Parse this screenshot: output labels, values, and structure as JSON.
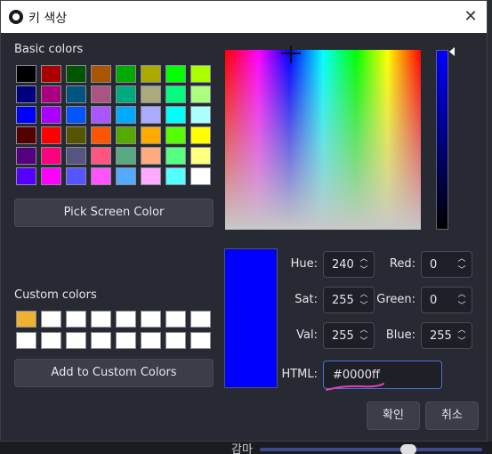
{
  "window": {
    "title": "키 색상",
    "close": "✕"
  },
  "basic": {
    "label": "Basic colors",
    "swatches": [
      "#000000",
      "#aa0000",
      "#005500",
      "#aa5500",
      "#00aa00",
      "#aaaa00",
      "#00ff00",
      "#aaff00",
      "#00007f",
      "#aa007f",
      "#00557f",
      "#aa557f",
      "#00aa7f",
      "#aaaa7f",
      "#00ff7f",
      "#aaff7f",
      "#0000ff",
      "#aa00ff",
      "#0055ff",
      "#aa55ff",
      "#00aaff",
      "#aaaaff",
      "#00ffff",
      "#aaffff",
      "#550000",
      "#ff0000",
      "#555500",
      "#ff5500",
      "#55aa00",
      "#ffaa00",
      "#55ff00",
      "#ffff00",
      "#55007f",
      "#ff007f",
      "#55557f",
      "#ff557f",
      "#55aa7f",
      "#ffaa7f",
      "#55ff7f",
      "#ffff7f",
      "#5500ff",
      "#ff00ff",
      "#5555ff",
      "#ff55ff",
      "#55aaff",
      "#ffaaff",
      "#55ffff",
      "#ffffff"
    ]
  },
  "pick_screen_label": "Pick Screen Color",
  "custom": {
    "label": "Custom colors",
    "swatches": [
      "#f0b030",
      "#ffffff",
      "#ffffff",
      "#ffffff",
      "#ffffff",
      "#ffffff",
      "#ffffff",
      "#ffffff",
      "#ffffff",
      "#ffffff",
      "#ffffff",
      "#ffffff",
      "#ffffff",
      "#ffffff",
      "#ffffff",
      "#ffffff"
    ]
  },
  "add_custom_label": "Add to Custom Colors",
  "fields": {
    "hue": {
      "label": "Hue:",
      "value": "240"
    },
    "sat": {
      "label": "Sat:",
      "value": "255"
    },
    "val": {
      "label": "Val:",
      "value": "255"
    },
    "red": {
      "label": "Red:",
      "value": "0"
    },
    "green": {
      "label": "Green:",
      "value": "0"
    },
    "blue": {
      "label": "Blue:",
      "value": "255"
    },
    "html": {
      "label": "HTML:",
      "value": "#0000ff"
    }
  },
  "current_color": "#0000ff",
  "ok_label": "확인",
  "cancel_label": "취소",
  "background": {
    "label": "감마"
  }
}
